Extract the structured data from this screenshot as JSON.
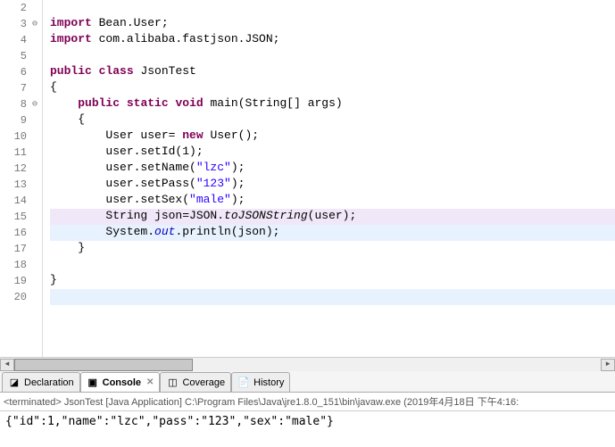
{
  "editor": {
    "lines": [
      {
        "n": 2,
        "marker": "",
        "hl": "",
        "tokens": []
      },
      {
        "n": 3,
        "marker": "⊖",
        "hl": "",
        "tokens": [
          [
            "kw",
            "import"
          ],
          [
            "plain",
            " Bean.User;"
          ]
        ]
      },
      {
        "n": 4,
        "marker": "",
        "hl": "",
        "tokens": [
          [
            "kw",
            "import"
          ],
          [
            "plain",
            " com.alibaba.fastjson.JSON;"
          ]
        ]
      },
      {
        "n": 5,
        "marker": "",
        "hl": "",
        "tokens": []
      },
      {
        "n": 6,
        "marker": "",
        "hl": "",
        "tokens": [
          [
            "kw",
            "public"
          ],
          [
            "plain",
            " "
          ],
          [
            "kw",
            "class"
          ],
          [
            "plain",
            " JsonTest"
          ]
        ]
      },
      {
        "n": 7,
        "marker": "",
        "hl": "",
        "tokens": [
          [
            "plain",
            "{"
          ]
        ]
      },
      {
        "n": 8,
        "marker": "⊖",
        "hl": "",
        "tokens": [
          [
            "plain",
            "    "
          ],
          [
            "kw",
            "public"
          ],
          [
            "plain",
            " "
          ],
          [
            "kw",
            "static"
          ],
          [
            "plain",
            " "
          ],
          [
            "kw",
            "void"
          ],
          [
            "plain",
            " main(String[] args)"
          ]
        ]
      },
      {
        "n": 9,
        "marker": "",
        "hl": "",
        "tokens": [
          [
            "plain",
            "    {"
          ]
        ]
      },
      {
        "n": 10,
        "marker": "",
        "hl": "",
        "tokens": [
          [
            "plain",
            "        User user= "
          ],
          [
            "kw",
            "new"
          ],
          [
            "plain",
            " User();"
          ]
        ]
      },
      {
        "n": 11,
        "marker": "",
        "hl": "",
        "tokens": [
          [
            "plain",
            "        user.setId(1);"
          ]
        ]
      },
      {
        "n": 12,
        "marker": "",
        "hl": "",
        "tokens": [
          [
            "plain",
            "        user.setName("
          ],
          [
            "str",
            "\"lzc\""
          ],
          [
            "plain",
            ");"
          ]
        ]
      },
      {
        "n": 13,
        "marker": "",
        "hl": "",
        "tokens": [
          [
            "plain",
            "        user.setPass("
          ],
          [
            "str",
            "\"123\""
          ],
          [
            "plain",
            ");"
          ]
        ]
      },
      {
        "n": 14,
        "marker": "",
        "hl": "",
        "tokens": [
          [
            "plain",
            "        user.setSex("
          ],
          [
            "str",
            "\"male\""
          ],
          [
            "plain",
            ");"
          ]
        ]
      },
      {
        "n": 15,
        "marker": "",
        "hl": "highlight2",
        "tokens": [
          [
            "plain",
            "        String json=JSON."
          ],
          [
            "static-method",
            "toJSONString"
          ],
          [
            "plain",
            "(user);"
          ]
        ]
      },
      {
        "n": 16,
        "marker": "",
        "hl": "highlight",
        "tokens": [
          [
            "plain",
            "        System."
          ],
          [
            "field",
            "out"
          ],
          [
            "plain",
            ".println(json);"
          ]
        ]
      },
      {
        "n": 17,
        "marker": "",
        "hl": "",
        "tokens": [
          [
            "plain",
            "    }"
          ]
        ]
      },
      {
        "n": 18,
        "marker": "",
        "hl": "",
        "tokens": []
      },
      {
        "n": 19,
        "marker": "",
        "hl": "",
        "tokens": [
          [
            "plain",
            "}"
          ]
        ]
      },
      {
        "n": 20,
        "marker": "",
        "hl": "highlight",
        "tokens": []
      }
    ]
  },
  "tabs": {
    "items": [
      {
        "label": "Declaration",
        "active": false,
        "icon": "declaration-icon",
        "glyph": "◪"
      },
      {
        "label": "Console",
        "active": true,
        "icon": "console-icon",
        "glyph": "▣"
      },
      {
        "label": "Coverage",
        "active": false,
        "icon": "coverage-icon",
        "glyph": "◫"
      },
      {
        "label": "History",
        "active": false,
        "icon": "history-icon",
        "glyph": "📄"
      }
    ],
    "close_glyph": "✕"
  },
  "console": {
    "status": "<terminated> JsonTest [Java Application] C:\\Program Files\\Java\\jre1.8.0_151\\bin\\javaw.exe (2019年4月18日 下午4:16:",
    "output": "{\"id\":1,\"name\":\"lzc\",\"pass\":\"123\",\"sex\":\"male\"}"
  },
  "scroll": {
    "left_glyph": "◄",
    "right_glyph": "►"
  }
}
